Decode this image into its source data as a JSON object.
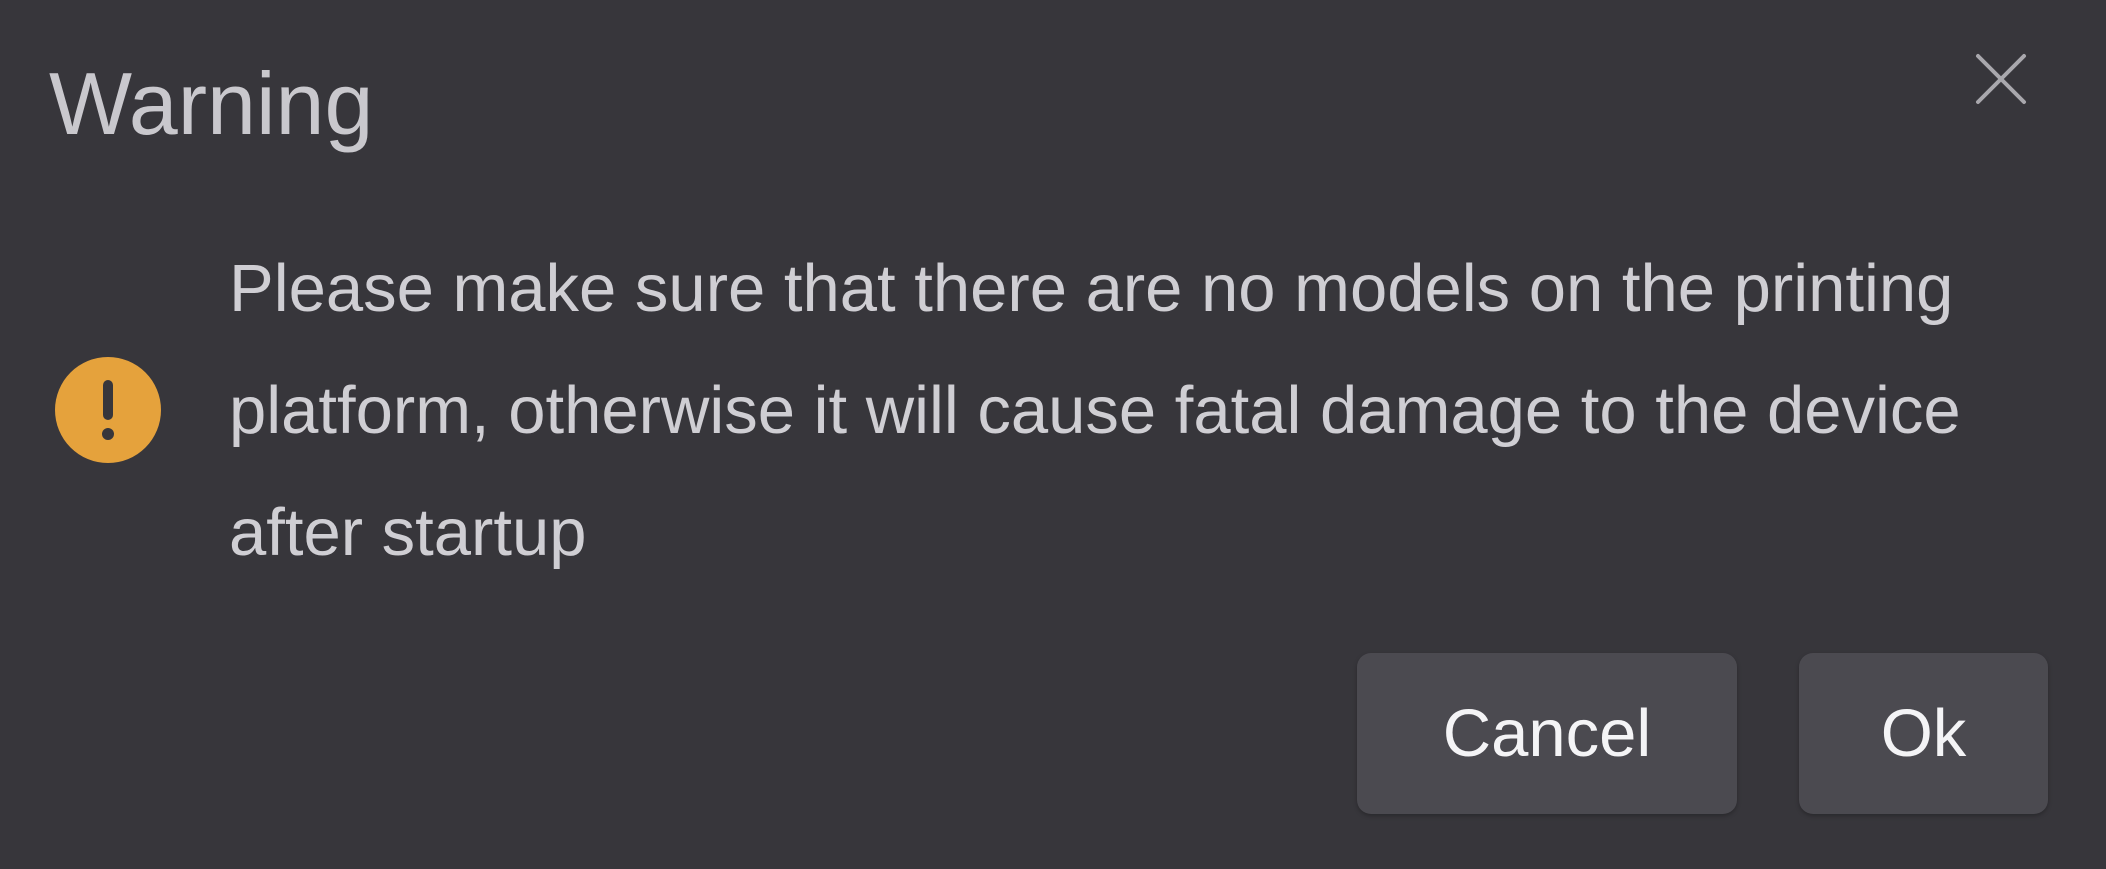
{
  "dialog": {
    "title": "Warning",
    "close_icon": "close-icon",
    "status_icon": "exclamation-circle-icon",
    "status_icon_color": "#e5a23c",
    "message": "Please make sure that there are no models on the printing platform, otherwise it will cause fatal damage to the device after startup",
    "buttons": {
      "cancel_label": "Cancel",
      "ok_label": "Ok"
    }
  },
  "colors": {
    "background": "#37363b",
    "button_background": "#4b4a50",
    "text": "#cfced3"
  }
}
